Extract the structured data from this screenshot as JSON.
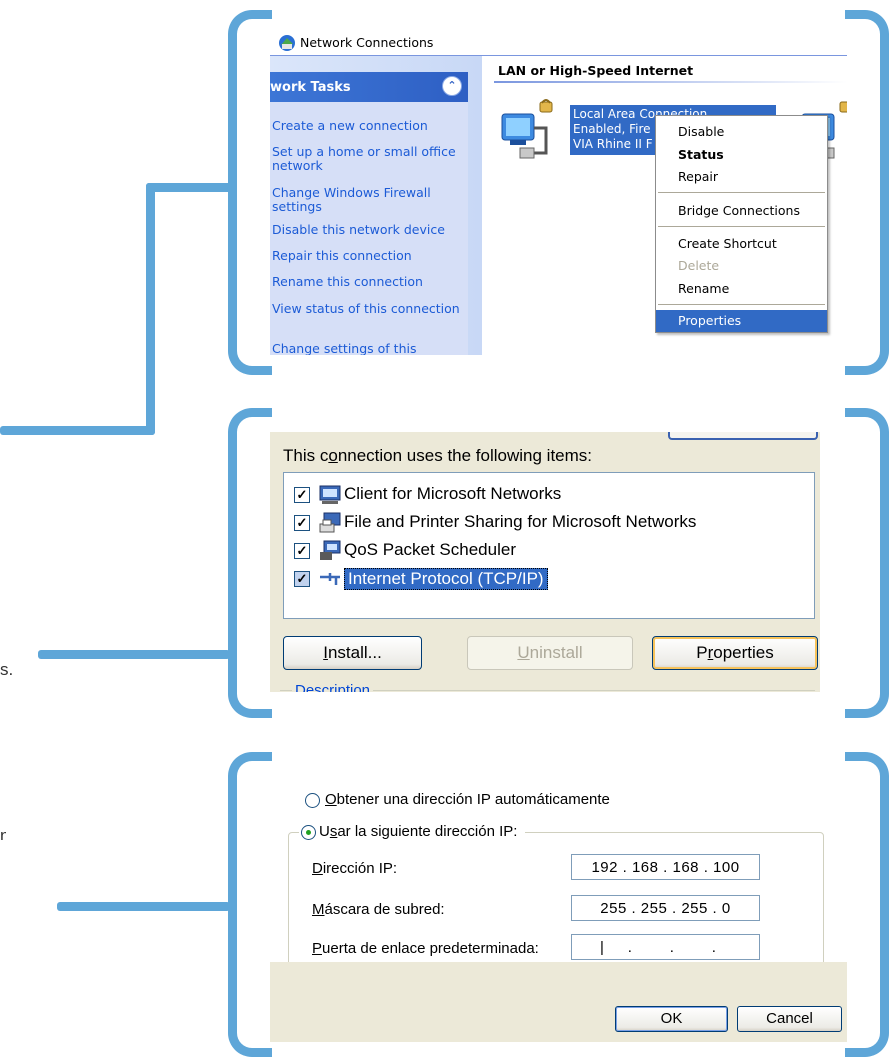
{
  "colors": {
    "bracket": "#5ea6d8",
    "xp_blue": "#316ac5",
    "link": "#1c5bd6"
  },
  "page": {
    "dot_text": "s."
  },
  "net_window": {
    "title": "Network Connections",
    "task_pane_title": "work Tasks",
    "collapse_icon": "double-chevron-up-icon",
    "tasks": [
      "Create a new connection",
      "Set up a home or small office network",
      "Change Windows Firewall settings",
      "Disable this network device",
      "Repair this connection",
      "Rename this connection",
      "View status of this connection",
      "Change settings of this"
    ],
    "section_title": "LAN or High-Speed Internet",
    "connection": {
      "name": "Local Area Connection",
      "status": "Enabled, Fire",
      "device": "VIA Rhine II F"
    },
    "context_menu": {
      "disable": "Disable",
      "status": "Status",
      "repair": "Repair",
      "bridge": "Bridge Connections",
      "shortcut": "Create Shortcut",
      "delete": "Delete",
      "rename": "Rename",
      "properties": "Properties"
    }
  },
  "props_dialog": {
    "caption_pre": "This c",
    "caption_acc": "o",
    "caption_post": "nnection uses the following items:",
    "items": [
      {
        "label": "Client for Microsoft Networks",
        "checked": true,
        "selected": false
      },
      {
        "label": "File and Printer Sharing for Microsoft Networks",
        "checked": true,
        "selected": false
      },
      {
        "label": "QoS Packet Scheduler",
        "checked": true,
        "selected": false
      },
      {
        "label": "Internet Protocol (TCP/IP)",
        "checked": true,
        "selected": true
      }
    ],
    "install_acc": "I",
    "install_rest": "nstall...",
    "uninstall_acc": "U",
    "uninstall_rest": "ninstall",
    "properties_pre": "P",
    "properties_acc": "r",
    "properties_rest": "operties",
    "description": "Description"
  },
  "tcpip_dialog": {
    "auto_acc": "O",
    "auto_rest": "btener una dirección IP automáticamente",
    "manual_pre": "U",
    "manual_acc": "s",
    "manual_rest": "ar la siguiente dirección IP:",
    "ip_acc": "D",
    "ip_rest": "irección IP:",
    "ip_value": "192 . 168 . 168 . 100",
    "mask_acc": "M",
    "mask_rest": "áscara de subred:",
    "mask_value": "255 . 255 . 255 .   0",
    "gw_acc": "P",
    "gw_rest": "uerta de enlace predeterminada:",
    "gw_value": "|     .        .        .",
    "ok": "OK",
    "cancel": "Cancel"
  }
}
